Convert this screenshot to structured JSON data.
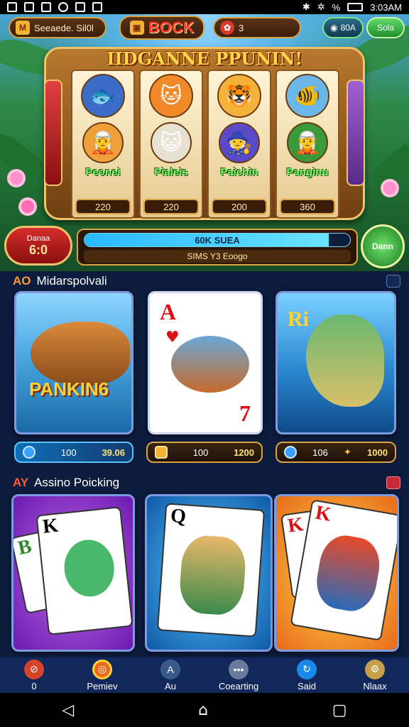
{
  "status_bar": {
    "time": "3:03AM"
  },
  "top_bar": {
    "coins_label": "Seeaede. Sil0l",
    "lock_label": "BOCK",
    "gem_value": "3",
    "currency_value": "80A",
    "settings_label": "Sola"
  },
  "slot": {
    "title": "IIDGANNE PPUNIN!",
    "reels": [
      {
        "name": "Peonei",
        "score": "220",
        "top_icon": "fish-face",
        "bottom_icon": "elf-face"
      },
      {
        "name": "Pialeis",
        "score": "220",
        "top_icon": "cat-face",
        "bottom_icon": "cat-warrior-face"
      },
      {
        "name": "Paichin",
        "score": "200",
        "top_icon": "cat-face-2",
        "bottom_icon": "wizard-face"
      },
      {
        "name": "Panginu",
        "score": "360",
        "top_icon": "fish-face-2",
        "bottom_icon": "elf-face-2"
      }
    ]
  },
  "controls": {
    "bet_label": "Danaa",
    "bet_value": "6:0",
    "progress_text": "60K SUEA",
    "progress_level": 0.92,
    "progress_sub": "SIMS Y3 Eoogo",
    "spin_label": "Dann"
  },
  "section1": {
    "tag": "AO",
    "title": "Midarspolvali",
    "cards": [
      {
        "label": "PANKIN6",
        "stat_left": "100",
        "stat_right": "39.06"
      },
      {
        "label": "",
        "stat_left": "100",
        "stat_right": "1200",
        "card_rank": "A",
        "card_rank2": "7"
      },
      {
        "label": "",
        "stat_left": "106",
        "stat_right": "1000",
        "card_rank": "Ri"
      }
    ]
  },
  "section2": {
    "tag": "AY",
    "title": "Assino Poicking",
    "cards": [
      {
        "rank": "K"
      },
      {
        "rank": "Q"
      },
      {
        "rank": "K"
      }
    ]
  },
  "bottom_nav": {
    "items": [
      {
        "label": "0",
        "icon": "coin-icon"
      },
      {
        "label": "Pemiev",
        "icon": "ring-icon"
      },
      {
        "label": "Au",
        "icon": "shield-icon"
      },
      {
        "label": "Coearting",
        "icon": "chat-icon"
      },
      {
        "label": "Said",
        "icon": "refresh-icon"
      },
      {
        "label": "Nlaax",
        "icon": "gear-icon"
      }
    ]
  },
  "colors": {
    "accent": "#ffcf3a",
    "panel": "#12275a",
    "frame": "#d9a441"
  }
}
